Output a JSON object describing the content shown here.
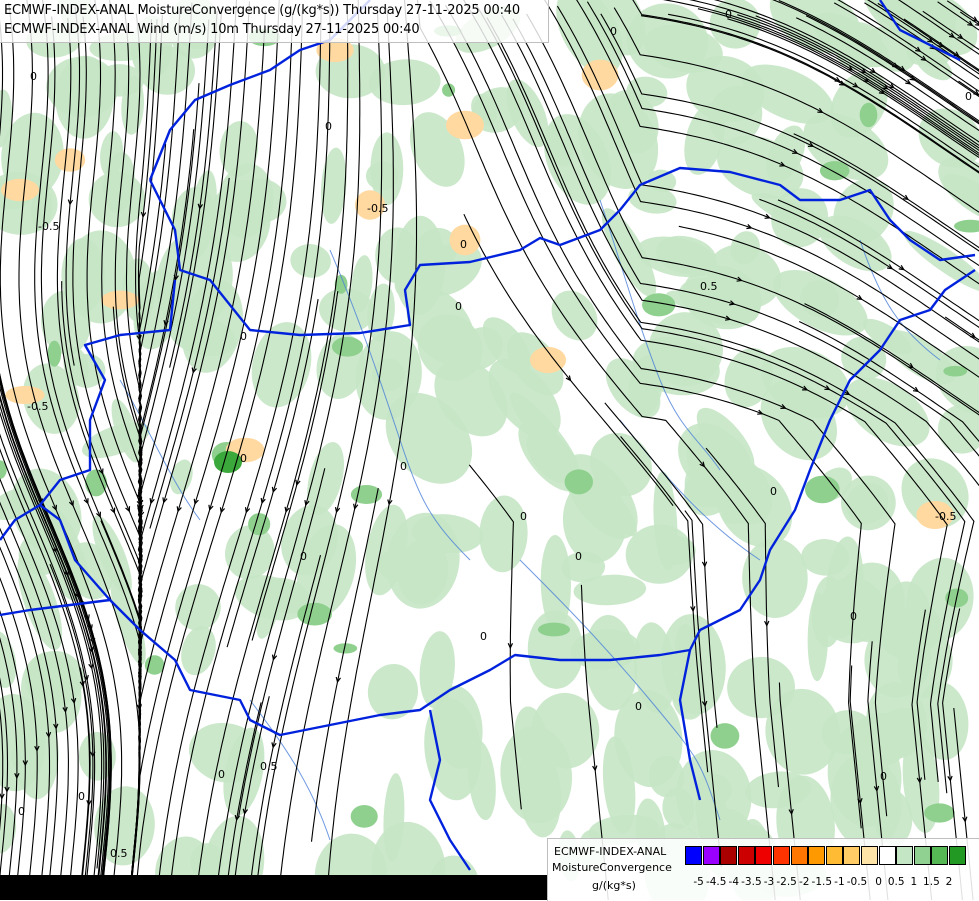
{
  "title": {
    "line1": "ECMWF-INDEX-ANAL MoistureConvergence (g/(kg*s)) Thursday 27-11-2025 00:40",
    "line2": "ECMWF-INDEX-ANAL Wind (m/s) 10m Thursday 27-11-2025 00:40"
  },
  "legend": {
    "line1": "ECMWF-INDEX-ANAL",
    "line2": "MoistureConvergence",
    "unit": "g/(kg*s)",
    "ticks": [
      "-5",
      "-4.5",
      "-4",
      "-3.5",
      "-3",
      "-2.5",
      "-2",
      "-1.5",
      "-1",
      "-0.5",
      "0",
      "0.5",
      "1",
      "1.5",
      "2"
    ],
    "colors": [
      "#0000ff",
      "#9900ff",
      "#aa0000",
      "#cc0000",
      "#ee0000",
      "#ff3300",
      "#ff7700",
      "#ff9900",
      "#ffbb33",
      "#ffcc66",
      "#ffe4a8",
      "#ffffff",
      "#c5e6c5",
      "#90d090",
      "#55b855",
      "#229922"
    ]
  },
  "contour_labels": [
    "0",
    "0",
    "-0.5",
    "0",
    "0",
    "-0.5",
    "0",
    "-0.5",
    "0",
    "0",
    "-0.5",
    "0",
    "0",
    "0",
    "0",
    "0",
    "0.5",
    "0",
    "0",
    "0",
    "0",
    "0.5",
    "0",
    "0",
    "0",
    "0.5",
    "0",
    "0"
  ],
  "map": {
    "field_colors": {
      "land": "#ffffff",
      "convergence": "#c5e6c5",
      "strong_convergence": "#8fd08f",
      "divergence": "#ffd9a0"
    },
    "border_color": "#0022dd",
    "river_color": "#4a7fd8",
    "streamline_color": "#000000"
  }
}
